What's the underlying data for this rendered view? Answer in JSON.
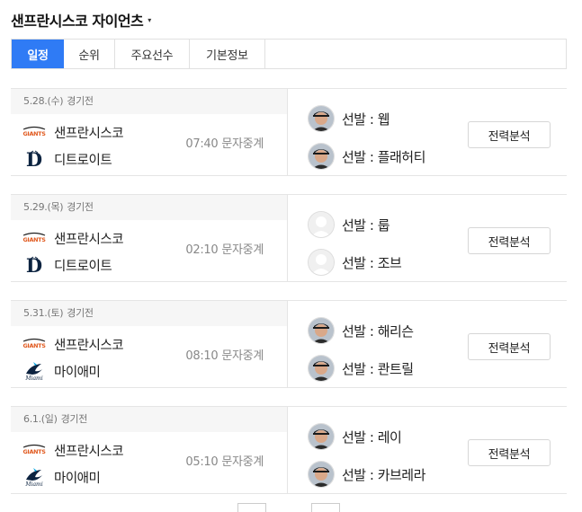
{
  "header": {
    "team_name": "샌프란시스코 자이언츠",
    "caret": "▾"
  },
  "tabs": [
    {
      "label": "일정",
      "active": true
    },
    {
      "label": "순위",
      "active": false
    },
    {
      "label": "주요선수",
      "active": false
    },
    {
      "label": "기본정보",
      "active": false
    }
  ],
  "games": [
    {
      "date": "5.28.(수)",
      "label": "경기전",
      "home": "샌프란시스코",
      "away": "디트로이트",
      "time": "07:40",
      "relay": "문자중계",
      "pitchers": [
        {
          "prefix": "선발 : ",
          "name": "웹",
          "photo": true
        },
        {
          "prefix": "선발 : ",
          "name": "플래허티",
          "photo": true
        }
      ],
      "analysis": "전력분석"
    },
    {
      "date": "5.29.(목)",
      "label": "경기전",
      "home": "샌프란시스코",
      "away": "디트로이트",
      "time": "02:10",
      "relay": "문자중계",
      "pitchers": [
        {
          "prefix": "선발 : ",
          "name": "룹",
          "photo": false
        },
        {
          "prefix": "선발 : ",
          "name": "조브",
          "photo": false
        }
      ],
      "analysis": "전력분석"
    },
    {
      "date": "5.31.(토)",
      "label": "경기전",
      "home": "샌프란시스코",
      "away": "마이애미",
      "time": "08:10",
      "relay": "문자중계",
      "pitchers": [
        {
          "prefix": "선발 : ",
          "name": "해리슨",
          "photo": true
        },
        {
          "prefix": "선발 : ",
          "name": "콴트릴",
          "photo": true
        }
      ],
      "analysis": "전력분석"
    },
    {
      "date": "6.1.(일)",
      "label": "경기전",
      "home": "샌프란시스코",
      "away": "마이애미",
      "time": "05:10",
      "relay": "문자중계",
      "pitchers": [
        {
          "prefix": "선발 : ",
          "name": "레이",
          "photo": true
        },
        {
          "prefix": "선발 : ",
          "name": "카브레라",
          "photo": true
        }
      ],
      "analysis": "전력분석"
    }
  ],
  "colors": {
    "accent": "#2f7bf5",
    "giants_orange": "#e0581d",
    "tigers_navy": "#0c2340",
    "marlins_teal": "#00a3e0"
  },
  "icons": {
    "home_logo": "giants-logo",
    "away_logos": [
      "tigers-logo",
      "tigers-logo",
      "marlins-logo",
      "marlins-logo"
    ]
  }
}
